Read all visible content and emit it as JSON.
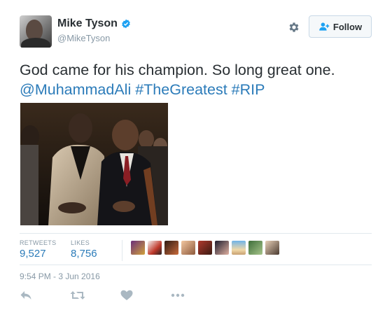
{
  "user": {
    "display_name": "Mike Tyson",
    "handle": "@MikeTyson",
    "verified": true
  },
  "follow_button": {
    "label": "Follow",
    "icon": "user-add-icon"
  },
  "settings_icon": "gear-icon",
  "tweet": {
    "text_plain": "God came for his champion. So long great one.",
    "mention": "@MuhammadAli",
    "hashtag_1": "#TheGreatest",
    "hashtag_2": "#RIP"
  },
  "stats": {
    "retweets_label": "RETWEETS",
    "retweets_value": "9,527",
    "likes_label": "LIKES",
    "likes_value": "8,756"
  },
  "liker_avatar_count": 9,
  "timestamp": "9:54 PM - 3 Jun 2016",
  "actions": [
    "reply-icon",
    "retweet-icon",
    "like-icon",
    "more-icon"
  ],
  "colors": {
    "link": "#2b7bb9",
    "muted": "#8899a6",
    "text": "#292f33",
    "verified": "#1da1f2",
    "border": "#e1e8ed"
  }
}
